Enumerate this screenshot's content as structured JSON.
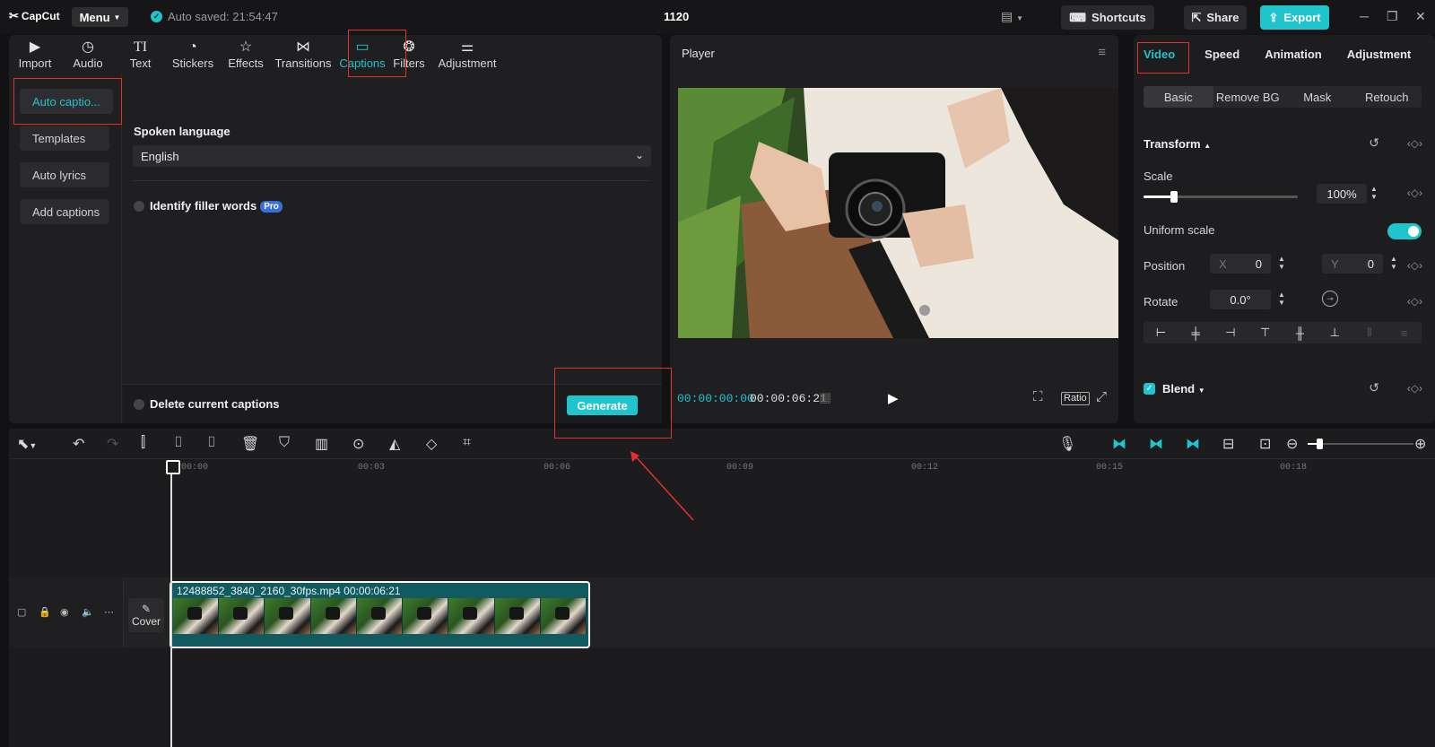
{
  "app": {
    "logo": "CapCut",
    "menu_label": "Menu",
    "autosave": "Auto saved: 21:54:47",
    "project_title": "1120"
  },
  "header_buttons": {
    "shortcuts": "Shortcuts",
    "share": "Share",
    "export": "Export"
  },
  "tools": [
    {
      "label": "Import",
      "icon": "import-icon"
    },
    {
      "label": "Audio",
      "icon": "audio-icon"
    },
    {
      "label": "Text",
      "icon": "text-icon"
    },
    {
      "label": "Stickers",
      "icon": "stickers-icon"
    },
    {
      "label": "Effects",
      "icon": "effects-icon"
    },
    {
      "label": "Transitions",
      "icon": "transitions-icon"
    },
    {
      "label": "Captions",
      "icon": "captions-icon",
      "active": true
    },
    {
      "label": "Filters",
      "icon": "filters-icon"
    },
    {
      "label": "Adjustment",
      "icon": "adjustment-icon"
    }
  ],
  "caption_nav": [
    "Auto captio...",
    "Templates",
    "Auto lyrics",
    "Add captions"
  ],
  "captions": {
    "spoken_language_label": "Spoken language",
    "language_value": "English",
    "filler_words_label": "Identify filler words",
    "pro_badge": "Pro",
    "delete_label": "Delete current captions",
    "generate_label": "Generate"
  },
  "player": {
    "title": "Player",
    "current_time": "00:00:00:00",
    "total_time": "00:00:06:21",
    "ratio_label": "Ratio"
  },
  "properties": {
    "tabs": [
      "Video",
      "Speed",
      "Animation",
      "Adjustment"
    ],
    "sub_tabs": [
      "Basic",
      "Remove BG",
      "Mask",
      "Retouch"
    ],
    "transform_label": "Transform",
    "scale_label": "Scale",
    "scale_value": "100%",
    "scale_fraction": 0.2,
    "uniform_scale_label": "Uniform scale",
    "position_label": "Position",
    "x_label": "X",
    "x_value": "0",
    "y_label": "Y",
    "y_value": "0",
    "rotate_label": "Rotate",
    "rotate_value": "0.0°",
    "blend_label": "Blend"
  },
  "timeline": {
    "ruler": [
      "00:00",
      "00:03",
      "00:06",
      "00:09",
      "00:12",
      "00:15",
      "00:18"
    ],
    "clip_label": "12488852_3840_2160_30fps.mp4  00:00:06:21",
    "cover_label": "Cover"
  },
  "colors": {
    "accent": "#1fc4cc",
    "highlight": "#e03030",
    "panel": "#1f1f22"
  }
}
